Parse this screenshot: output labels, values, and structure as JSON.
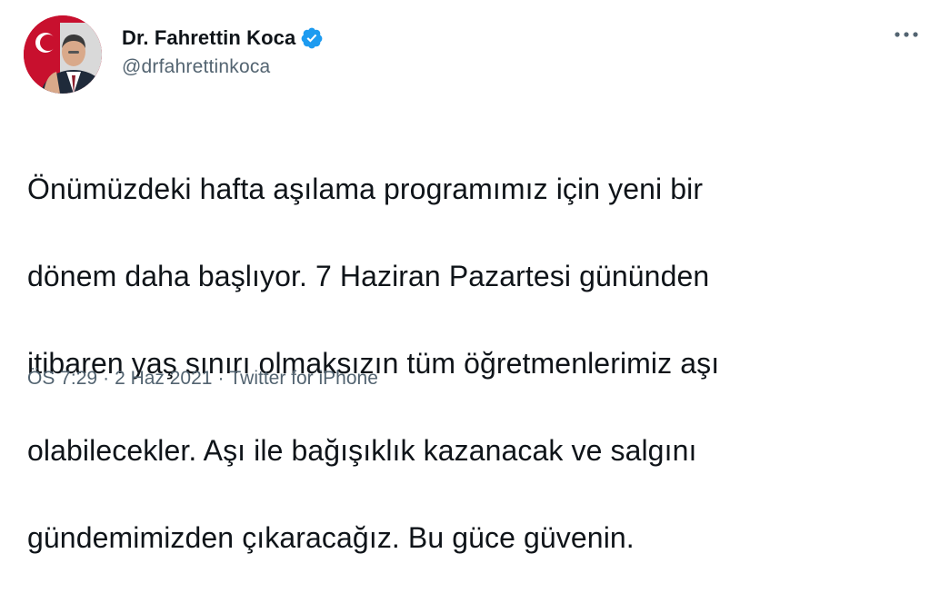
{
  "author": {
    "display_name": "Dr. Fahrettin Koca",
    "handle": "@drfahrettinkoca",
    "verified": true
  },
  "tweet": {
    "lines": [
      "Önümüzdeki hafta aşılama programımız için yeni bir",
      "dönem daha başlıyor. 7 Haziran Pazartesi gününden",
      "itibaren yaş sınırı olmaksızın tüm öğretmenlerimiz aşı",
      "olabilecekler. Aşı ile bağışıklık kazanacak ve salgını",
      "gündemimizden çıkaracağız. Bu güce güvenin."
    ]
  },
  "meta": {
    "time": "ÖS 7:29",
    "date": "2 Haz 2021",
    "source": "Twitter for iPhone",
    "separator": "·"
  },
  "icons": {
    "more": "more-horizontal-icon",
    "verified": "verified-badge-icon"
  },
  "colors": {
    "verified": "#1d9bf0",
    "secondary_text": "#536471",
    "primary_text": "#0f1419"
  }
}
